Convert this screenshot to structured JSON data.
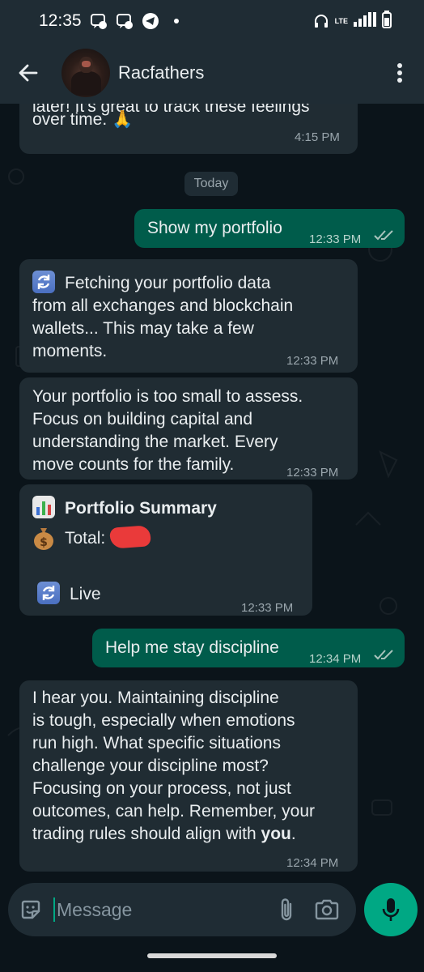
{
  "status_bar": {
    "time": "12:35",
    "network": "LTE"
  },
  "header": {
    "contact_name": "Racfathers"
  },
  "date_chip": "Today",
  "messages": [
    {
      "direction": "incoming",
      "lines": [
        "later! It's great to track these feelings",
        "over time. 🙏"
      ],
      "time": "4:15 PM"
    },
    {
      "direction": "outgoing",
      "text": "Show my portfolio",
      "time": "12:33 PM",
      "status": "read"
    },
    {
      "direction": "incoming",
      "icon": "refresh-icon",
      "lines": [
        "Fetching your portfolio data",
        "from all exchanges and blockchain",
        "wallets... This may take a few",
        "moments."
      ],
      "time": "12:33 PM"
    },
    {
      "direction": "incoming",
      "lines": [
        "Your portfolio is too small to assess.",
        "Focus on building capital and",
        "understanding the market. Every",
        "move counts for the family."
      ],
      "time": "12:33 PM"
    },
    {
      "direction": "incoming",
      "title": "Portfolio Summary",
      "total_label": "Total:",
      "total_value_redacted": true,
      "live_label": "Live",
      "time": "12:33 PM"
    },
    {
      "direction": "outgoing",
      "text": "Help me stay discipline",
      "time": "12:34 PM",
      "status": "read"
    },
    {
      "direction": "incoming",
      "lines": [
        "I hear you. Maintaining discipline",
        "is tough, especially when emotions",
        "run high. What specific situations",
        "challenge your discipline most?",
        "Focusing on your process, not just",
        "outcomes, can help. Remember, your",
        "trading rules should align with"
      ],
      "bold_end": "you",
      "end_punct": ".",
      "time": "12:34 PM"
    }
  ],
  "composer": {
    "placeholder": "Message"
  },
  "colors": {
    "background": "#0b141a",
    "header": "#1f2c34",
    "incoming_bubble": "#202c33",
    "outgoing_bubble": "#005c4b",
    "accent": "#00a884",
    "read_ticks": "#a8c3bc"
  }
}
